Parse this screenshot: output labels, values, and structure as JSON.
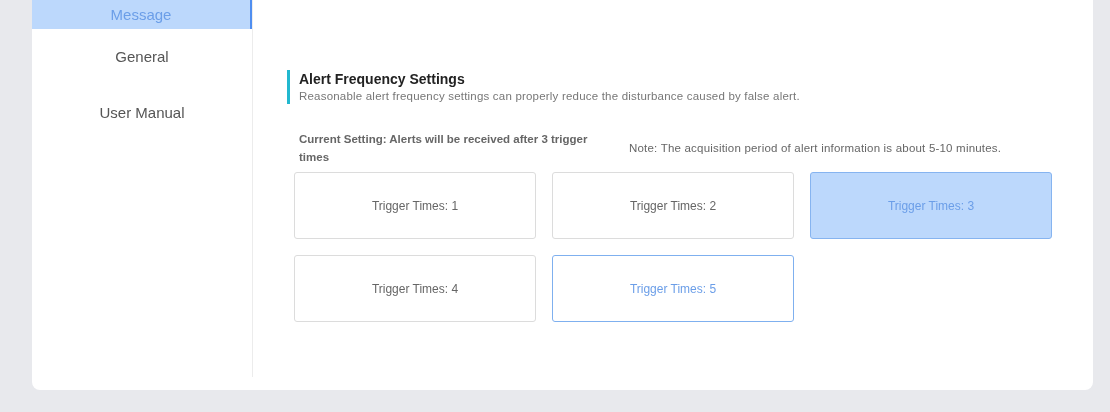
{
  "sidebar": {
    "items": [
      {
        "label": "Message",
        "selected": true
      },
      {
        "label": "General",
        "selected": false
      },
      {
        "label": "User Manual",
        "selected": false
      }
    ]
  },
  "section": {
    "title": "Alert Frequency Settings",
    "description": "Reasonable alert frequency settings can properly reduce the disturbance caused by false alert."
  },
  "current_setting": "Current Setting: Alerts will be received after 3 trigger times",
  "note": "Note: The acquisition period of alert information is about 5-10 minutes.",
  "options": [
    {
      "label": "Trigger Times: 1",
      "selected": false,
      "hovered": false
    },
    {
      "label": "Trigger Times: 2",
      "selected": false,
      "hovered": false
    },
    {
      "label": "Trigger Times: 3",
      "selected": true,
      "hovered": false
    },
    {
      "label": "Trigger Times: 4",
      "selected": false,
      "hovered": false
    },
    {
      "label": "Trigger Times: 5",
      "selected": false,
      "hovered": true
    }
  ]
}
